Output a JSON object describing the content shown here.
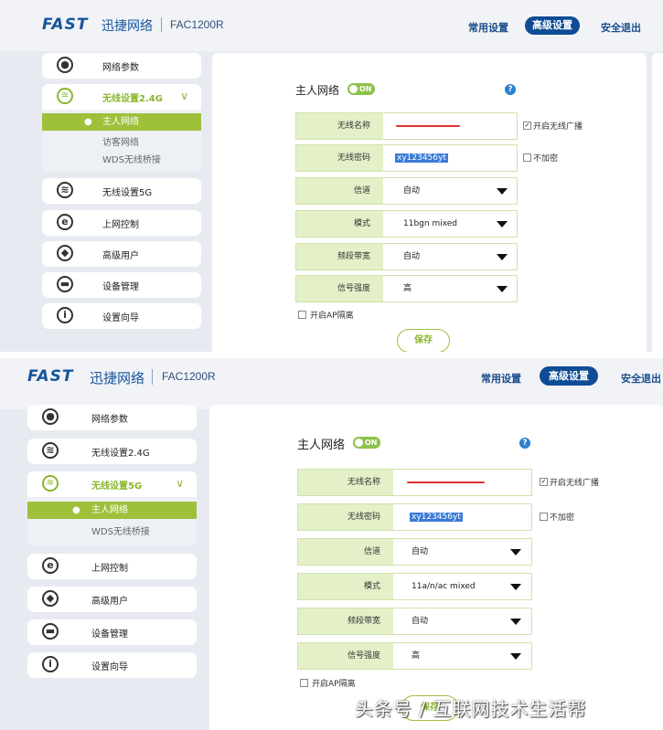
{
  "brand": {
    "logo": "FAST",
    "name": "迅捷网络",
    "model": "FAC1200R"
  },
  "nav": {
    "common": "常用设置",
    "advanced": "高级设置",
    "logout": "安全退出"
  },
  "sidebar": {
    "network_params": "网络参数",
    "wireless_24g": "无线设置2.4G",
    "wireless_5g": "无线设置5G",
    "internet_control": "上网控制",
    "advanced_users": "高级用户",
    "device_mgmt": "设备管理",
    "setup_wizard": "设置向导",
    "sub_main": "主人网络",
    "sub_guest": "访客网络",
    "sub_wds": "WDS无线桥接"
  },
  "panel1": {
    "section_title": "主人网络",
    "toggle": "ON",
    "help": "?",
    "labels": {
      "ssid": "无线名称",
      "password": "无线密码",
      "channel": "信道",
      "mode": "模式",
      "bandwidth": "频段带宽",
      "signal": "信号强度"
    },
    "values": {
      "password": "xy123456yt",
      "channel": "自动",
      "mode": "11bgn mixed",
      "bandwidth": "自动",
      "signal": "高"
    },
    "broadcast": "开启无线广播",
    "no_encrypt": "不加密",
    "ap_isolation": "开启AP隔离",
    "save": "保存"
  },
  "panel2": {
    "section_title": "主人网络",
    "toggle": "ON",
    "help": "?",
    "labels": {
      "ssid": "无线名称",
      "password": "无线密码",
      "channel": "信道",
      "mode": "模式",
      "bandwidth": "频段带宽",
      "signal": "信号强度"
    },
    "values": {
      "password": "xy123456yt",
      "channel": "自动",
      "mode": "11a/n/ac mixed",
      "bandwidth": "自动",
      "signal": "高"
    },
    "broadcast": "开启无线广播",
    "no_encrypt": "不加密",
    "ap_isolation": "开启AP隔离",
    "save": "保存"
  },
  "watermark": "头条号 / 互联网技术生活帮",
  "colors": {
    "accent_green": "#9ec03a",
    "brand_blue": "#0e4c95",
    "label_bg": "#e3f0c8"
  }
}
